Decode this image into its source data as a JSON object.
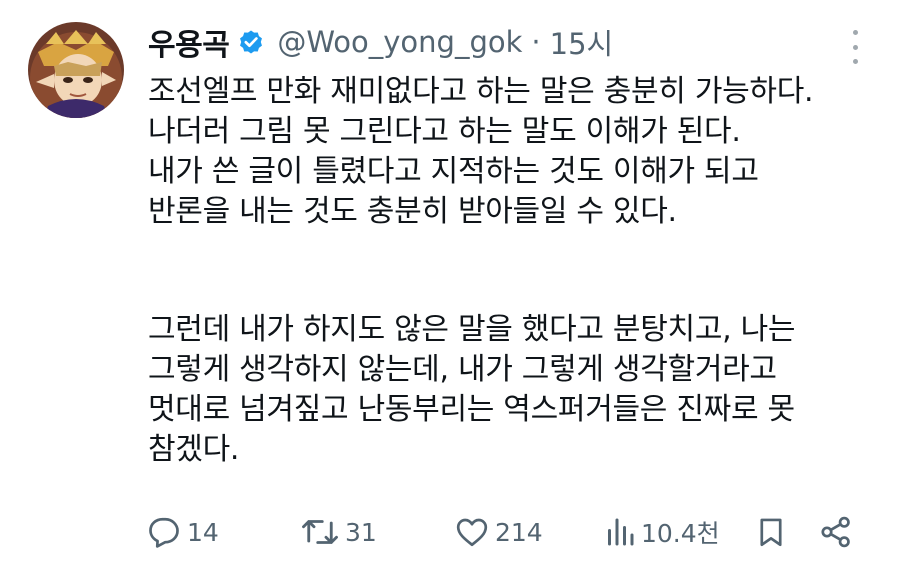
{
  "tweet": {
    "display_name": "우용곡",
    "handle": "@Woo_yong_gok",
    "separator": "·",
    "time": "15시",
    "lines": [
      "조선엘프 만화 재미없다고 하는 말은 충분히 가능하다.",
      "나더러 그림 못 그린다고 하는 말도 이해가 된다.",
      "내가 쓴 글이 틀렸다고 지적하는 것도 이해가 되고",
      "반론을 내는 것도 충분히 받아들일 수 있다.",
      "그런데 내가 하지도 않은 말을 했다고 분탕치고, 나는",
      "그렇게 생각하지 않는데, 내가 그렇게 생각할거라고",
      "멋대로 넘겨짚고 난동부리는 역스퍼거들은 진짜로 못",
      "참겠다."
    ],
    "stats": {
      "replies": "14",
      "retweets": "31",
      "likes": "214",
      "views": "10.4천"
    }
  },
  "colors": {
    "text": "#0f1419",
    "secondary": "#536471",
    "verified": "#1d9bf0"
  },
  "icons": [
    "verified-badge-icon",
    "more-options-icon",
    "reply-icon",
    "retweet-icon",
    "like-icon",
    "views-icon",
    "bookmark-icon",
    "share-icon"
  ]
}
